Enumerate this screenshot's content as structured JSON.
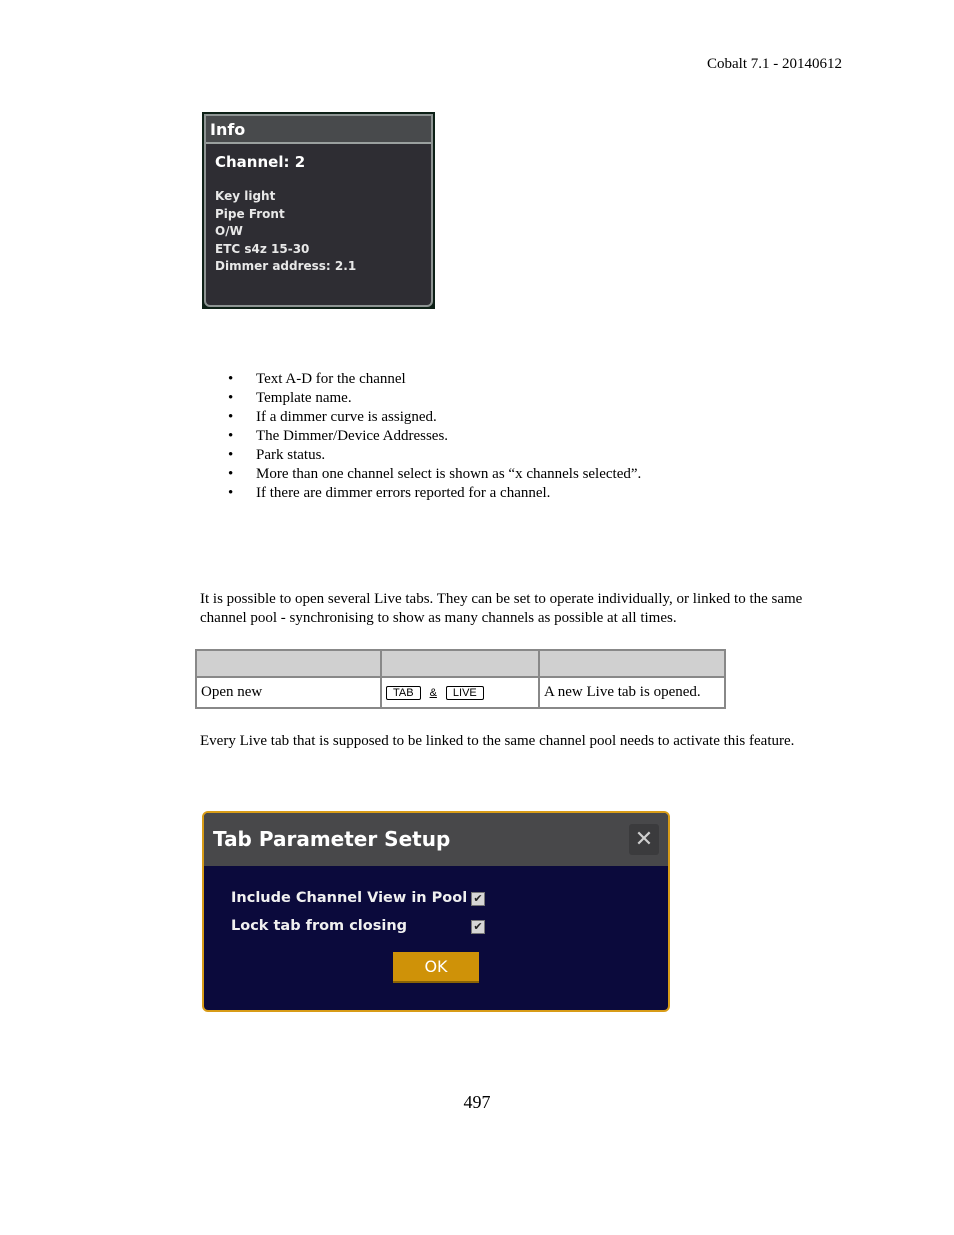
{
  "header": {
    "doc_version": "Cobalt 7.1 - 20140612"
  },
  "info_panel": {
    "title": "Info",
    "channel": "Channel: 2",
    "lines": [
      "Key light",
      "Pipe Front",
      "O/W",
      "ETC s4z 15-30",
      "Dimmer address: 2.1"
    ]
  },
  "bullets": [
    "Text A-D for the channel",
    "Template name.",
    "If a dimmer curve is assigned.",
    "The Dimmer/Device Addresses.",
    "Park status.",
    "More than one channel select is shown as “x channels selected”.",
    "If there are dimmer errors reported for a channel."
  ],
  "paragraph_live_tabs": "It is possible to open several Live tabs. They can be set to operate individually, or linked to the same channel pool - synchronising to show as many channels as possible at all times.",
  "table": {
    "headers": [
      "",
      "",
      ""
    ],
    "rows": [
      {
        "action": "Open new",
        "key1": "TAB",
        "joiner": "&",
        "key2": "LIVE",
        "result": "A new Live tab is opened."
      }
    ]
  },
  "paragraph_linked": "Every Live tab that is supposed to be linked to the same channel pool needs to activate this feature.",
  "dialog": {
    "title": "Tab Parameter Setup",
    "close_symbol": "✕",
    "options": [
      {
        "label": "Include Channel View in Pool",
        "checked": true
      },
      {
        "label": "Lock tab from closing",
        "checked": true
      }
    ],
    "check_symbol": "✔",
    "ok_label": "OK",
    "colors": {
      "border": "#d89c18",
      "body": "#0b0a3c",
      "ok_button": "#cf9208"
    }
  },
  "footer": {
    "page_number": "497"
  }
}
